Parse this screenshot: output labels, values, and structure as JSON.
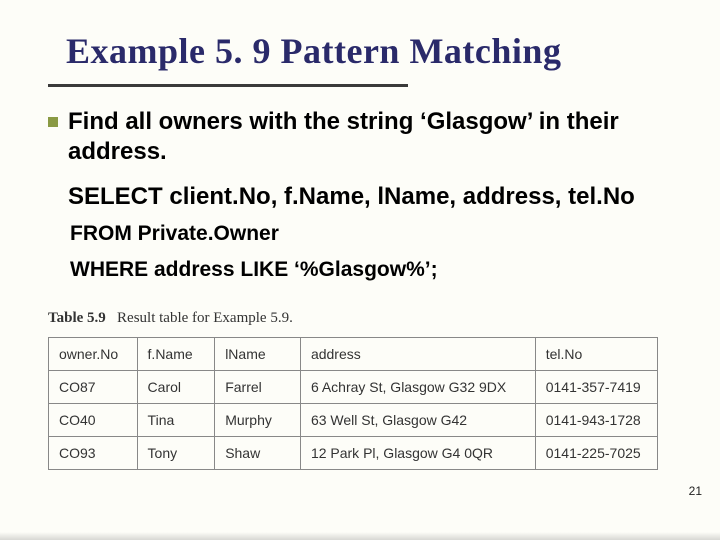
{
  "title": "Example 5. 9  Pattern Matching",
  "description": "Find all owners with the string ‘Glasgow’ in their address.",
  "sql_select": "SELECT client.No, f.Name, lName, address, tel.No",
  "sql_from": "FROM Private.Owner",
  "sql_where": "WHERE address LIKE ‘%Glasgow%’;",
  "table": {
    "caption_label": "Table 5.9",
    "caption_text": "Result table for Example 5.9.",
    "headers": [
      "owner.No",
      "f.Name",
      "lName",
      "address",
      "tel.No"
    ],
    "rows": [
      [
        "CO87",
        "Carol",
        "Farrel",
        "6 Achray St, Glasgow G32 9DX",
        "0141-357-7419"
      ],
      [
        "CO40",
        "Tina",
        "Murphy",
        "63 Well St, Glasgow G42",
        "0141-943-1728"
      ],
      [
        "CO93",
        "Tony",
        "Shaw",
        "12 Park Pl, Glasgow G4 0QR",
        "0141-225-7025"
      ]
    ]
  },
  "page_number": "21"
}
